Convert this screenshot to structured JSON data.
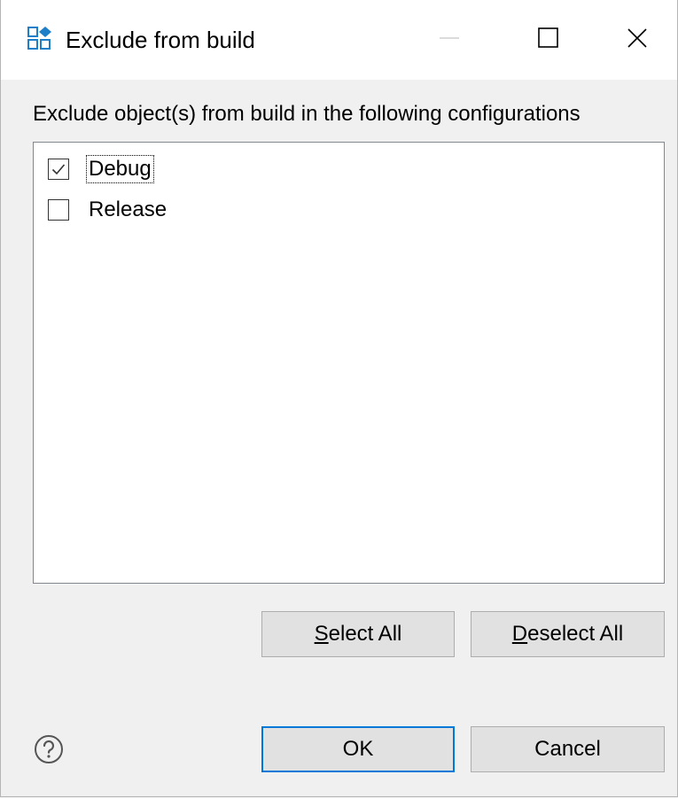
{
  "window": {
    "title": "Exclude from build",
    "icon": "configuration-grid-icon",
    "controls": {
      "minimize": "minimize-icon",
      "maximize": "maximize-icon",
      "close": "close-icon"
    }
  },
  "dialog": {
    "instruction": "Exclude object(s) from build in the following configurations",
    "configurations": [
      {
        "label": "Debug",
        "checked": true,
        "focused": true
      },
      {
        "label": "Release",
        "checked": false,
        "focused": false
      }
    ]
  },
  "buttons": {
    "select_all": {
      "mnemonic": "S",
      "rest": "elect All"
    },
    "deselect_all": {
      "mnemonic": "D",
      "rest": "eselect All"
    },
    "ok": "OK",
    "cancel": "Cancel",
    "help_icon": "help-icon"
  },
  "colors": {
    "accent": "#0078d7",
    "dialog_bg": "#f0f0f0",
    "button_bg": "#e1e1e1",
    "icon_blue": "#1e7fc8"
  }
}
